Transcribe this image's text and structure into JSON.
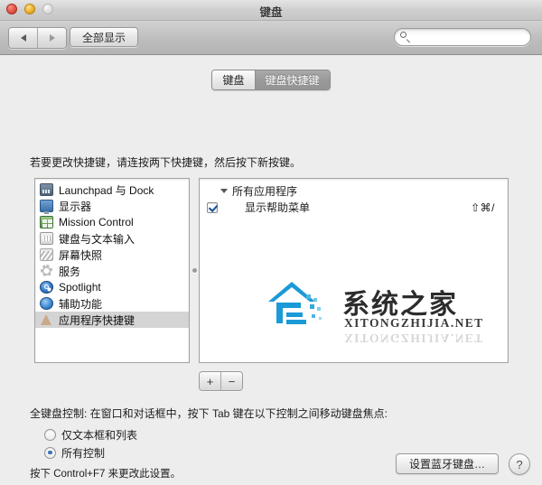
{
  "window": {
    "title": "键盘",
    "controls": {
      "close": "close-button",
      "minimize": "minimize-button",
      "zoom": "zoom-button"
    }
  },
  "toolbar": {
    "back_label": "◀",
    "forward_label": "▶",
    "show_all_label": "全部显示",
    "search_value": "",
    "search_placeholder": ""
  },
  "tabs": [
    {
      "label": "键盘",
      "active": false
    },
    {
      "label": "键盘快捷键",
      "active": true
    }
  ],
  "hint": "若要更改快捷键，请连按两下快捷键，然后按下新按键。",
  "categories": [
    {
      "label": "Launchpad 与 Dock",
      "icon": "launchpad-icon",
      "selected": false
    },
    {
      "label": "显示器",
      "icon": "display-icon",
      "selected": false
    },
    {
      "label": "Mission Control",
      "icon": "mission-control-icon",
      "selected": false
    },
    {
      "label": "键盘与文本输入",
      "icon": "keyboard-icon",
      "selected": false
    },
    {
      "label": "屏幕快照",
      "icon": "screenshot-icon",
      "selected": false
    },
    {
      "label": "服务",
      "icon": "services-icon",
      "selected": false
    },
    {
      "label": "Spotlight",
      "icon": "spotlight-icon",
      "selected": false
    },
    {
      "label": "辅助功能",
      "icon": "accessibility-icon",
      "selected": false
    },
    {
      "label": "应用程序快捷键",
      "icon": "app-shortcuts-icon",
      "selected": true
    }
  ],
  "shortcuts": {
    "group_label": "所有应用程序",
    "items": [
      {
        "checked": true,
        "name": "显示帮助菜单",
        "keys": "⇧⌘/"
      }
    ]
  },
  "list_buttons": {
    "add_label": "+",
    "remove_label": "−"
  },
  "full_keyboard_control": {
    "title": "全键盘控制: 在窗口和对话框中，按下 Tab 键在以下控制之间移动键盘焦点:",
    "options": [
      {
        "label": "仅文本框和列表",
        "selected": false
      },
      {
        "label": "所有控制",
        "selected": true
      }
    ],
    "note": "按下 Control+F7 来更改此设置。"
  },
  "footer": {
    "bluetooth_button": "设置蓝牙键盘…",
    "help_button": "?"
  },
  "watermark": {
    "chinese": "系统之家",
    "english": "XITONGZHIJIA.NET",
    "color": "#1a9ad7"
  },
  "colors": {
    "accent": "#3b74b8",
    "window_bg": "#ededed",
    "selection": "#d4d4d4"
  }
}
